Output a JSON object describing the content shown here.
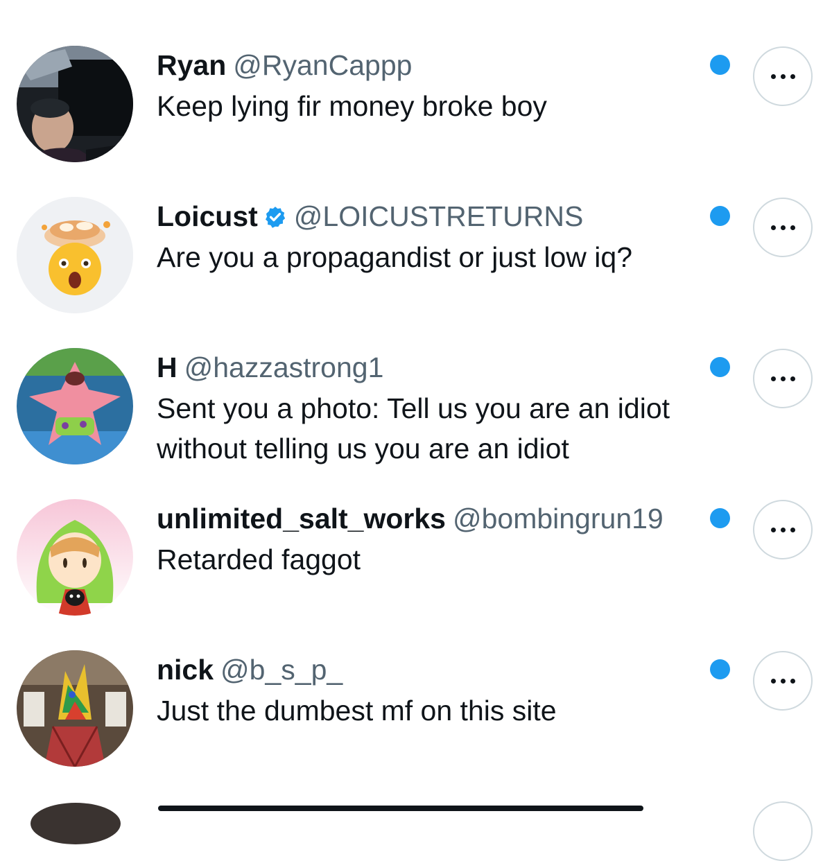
{
  "conversations": [
    {
      "display_name": "Ryan",
      "handle": "@RyanCappp",
      "verified": false,
      "message_lines": [
        "Keep lying fir money broke boy"
      ],
      "unread": true,
      "avatar": "photo-man-in-car"
    },
    {
      "display_name": "Loicust",
      "handle": "@LOICUSTRETURNS",
      "verified": true,
      "message_lines": [
        "Are you a propagandist or just low iq?"
      ],
      "unread": true,
      "avatar": "exploding-head-emoji"
    },
    {
      "display_name": "H",
      "handle": "@hazzastrong1",
      "verified": false,
      "message_lines": [
        "Sent you a photo: Tell us you are an idiot",
        "without telling us you are an idiot"
      ],
      "unread": true,
      "avatar": "cartoon-starfish"
    },
    {
      "display_name": "unlimited_salt_works",
      "handle": "@bombingrun19",
      "verified": false,
      "message_lines": [
        "Retarded faggot"
      ],
      "unread": true,
      "avatar": "anime-girl-green-hood"
    },
    {
      "display_name": "nick",
      "handle": "@b_s_p_",
      "verified": false,
      "message_lines": [
        "Just the dumbest mf on this site"
      ],
      "unread": true,
      "avatar": "person-with-pinata-head"
    }
  ],
  "colors": {
    "unread_dot": "#1d9bf0",
    "handle": "#536471",
    "text": "#0f1419",
    "border": "#cfd9de"
  },
  "icons": {
    "more": "more-horizontal-icon",
    "verified": "verified-badge-icon"
  }
}
